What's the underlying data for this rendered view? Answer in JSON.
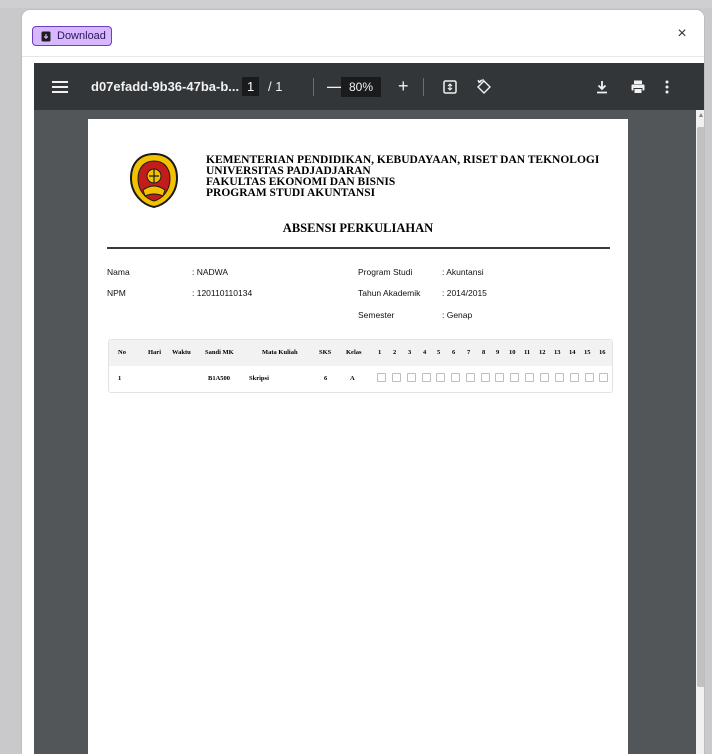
{
  "modal": {
    "download_label": "Download",
    "close_symbol": "×"
  },
  "viewer": {
    "doc_title": "d07efadd-9b36-47ba-b...",
    "page_current": "1",
    "page_total_text": "/ 1",
    "zoom_out_symbol": "—",
    "zoom": "80%",
    "zoom_in_symbol": "+"
  },
  "document": {
    "institution": [
      "KEMENTERIAN PENDIDIKAN, KEBUDAYAAN, RISET DAN TEKNOLOGI",
      "UNIVERSITAS PADJADJARAN",
      "FAKULTAS EKONOMI DAN BISNIS",
      "PROGRAM STUDI AKUNTANSI"
    ],
    "title": "ABSENSI PERKULIAHAN",
    "info_left": [
      {
        "label": "Nama",
        "value": ": NADWA"
      },
      {
        "label": "NPM",
        "value": ": 120110110134"
      }
    ],
    "info_right": [
      {
        "label": "Program Studi",
        "value": ": Akuntansi"
      },
      {
        "label": "Tahun Akademik",
        "value": ": 2014/2015"
      },
      {
        "label": "Semester",
        "value": ": Genap"
      }
    ],
    "table": {
      "headers": [
        "No",
        "Hari",
        "Waktu",
        "Sandi MK",
        "Mata Kuliah",
        "SKS",
        "Kelas",
        "1",
        "2",
        "3",
        "4",
        "5",
        "6",
        "7",
        "8",
        "9",
        "10",
        "11",
        "12",
        "13",
        "14",
        "15",
        "16"
      ],
      "rows": [
        {
          "no": "1",
          "hari": "",
          "waktu": "",
          "sandi": "B1A500",
          "mata_kuliah": "Skripsi",
          "sks": "6",
          "kelas": "A"
        }
      ]
    }
  },
  "colors": {
    "download_bg": "#d7b8ff",
    "toolbar": "#323639",
    "viewer_bg": "#525659"
  }
}
